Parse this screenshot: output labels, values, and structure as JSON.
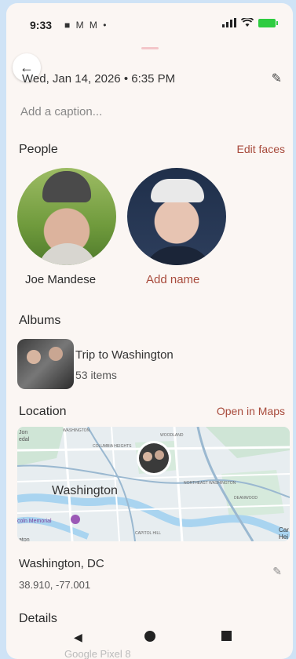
{
  "status_bar": {
    "time": "9:33",
    "notifications": "■ M M •"
  },
  "header": {
    "back_icon": "arrow-left-icon",
    "date": "Wed, Jan 14, 2026 • 6:35 PM",
    "caption_placeholder": "Add a caption..."
  },
  "people": {
    "title": "People",
    "action": "Edit faces",
    "items": [
      {
        "label": "Joe Mandese"
      },
      {
        "label": "Add name"
      }
    ]
  },
  "albums": {
    "title": "Albums",
    "item": {
      "name": "Trip to Washington",
      "count": "53 items"
    }
  },
  "location": {
    "title": "Location",
    "action": "Open in Maps",
    "map_labels": {
      "city": "Washington",
      "north": "WOODLAND",
      "northeast": "NORTHEAST WASHINGTON",
      "columbia": "COLUMBIA HEIGHTS",
      "capitol": "CAPITOL HILL",
      "memorial": "coln Memorial",
      "deanwood": "DEANWOOD",
      "washington_top": "WASHINGTON",
      "left_top": "Jon",
      "left_top2": "edal",
      "car": "Car",
      "car2": "Hei",
      "bottom_left": "aton"
    },
    "name": "Washington, DC",
    "coords": "38.910, -77.001"
  },
  "details": {
    "title": "Details",
    "footer_faint": "Google Pixel 8"
  },
  "colors": {
    "accent": "#a84b3c",
    "background": "#fbf6f3",
    "page_bg": "#cfe3f6"
  }
}
